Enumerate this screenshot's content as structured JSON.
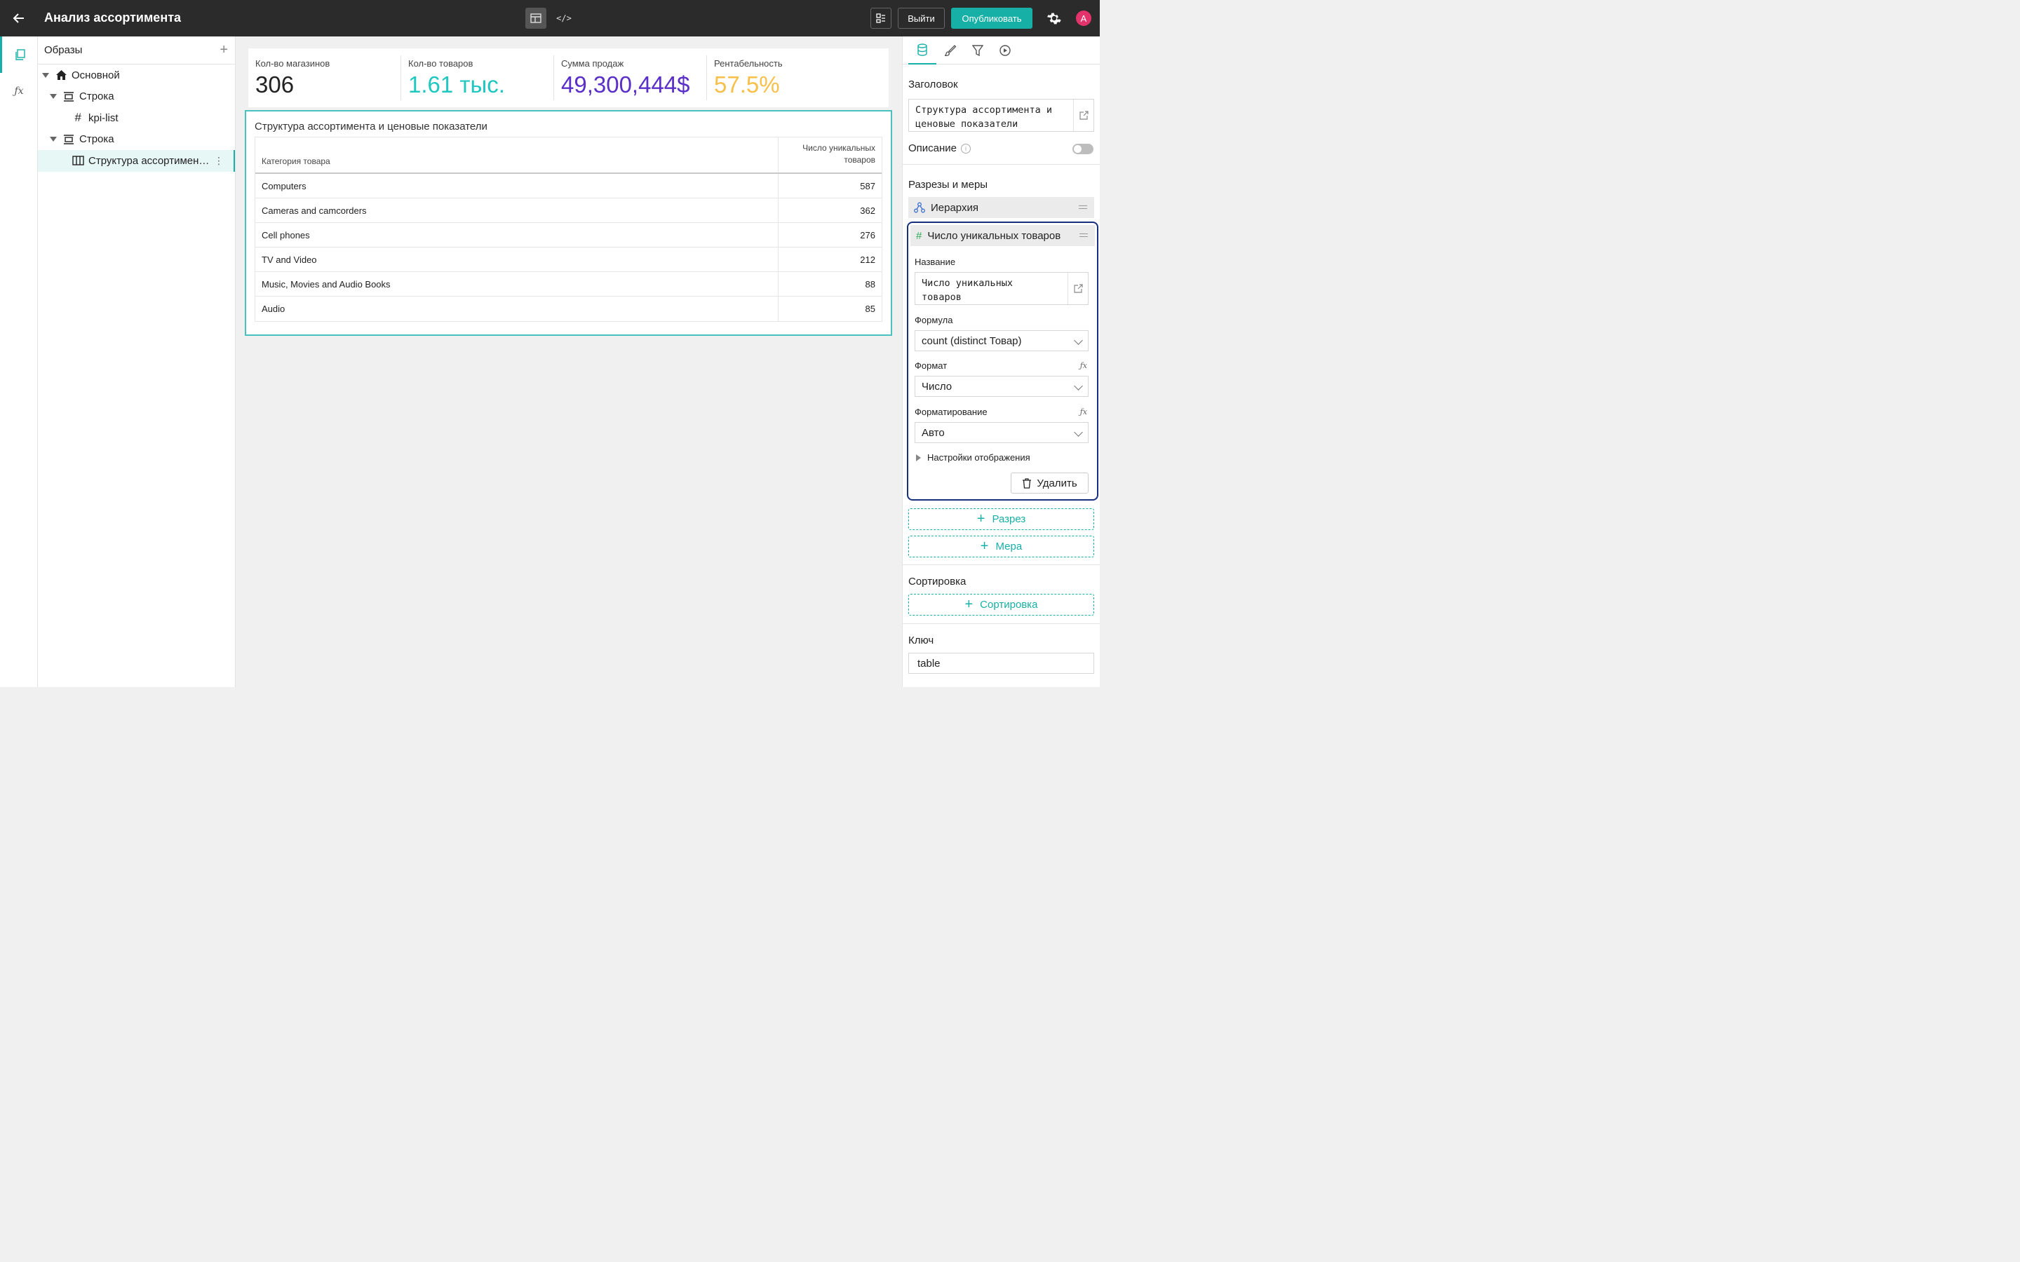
{
  "app": {
    "title": "Анализ ассортимента",
    "exit_label": "Выйти",
    "publish_label": "Опубликовать",
    "avatar_letter": "A",
    "code_mode_label": "</>"
  },
  "tree": {
    "header": "Образы",
    "nodes": [
      {
        "label": "Основной",
        "icon": "home-icon"
      },
      {
        "label": "Строка",
        "icon": "row-icon"
      },
      {
        "label": "kpi-list",
        "icon": "hash-icon"
      },
      {
        "label": "Строка",
        "icon": "row-icon"
      },
      {
        "label": "Структура ассортимента и ценовые показатели",
        "icon": "table-icon"
      }
    ]
  },
  "kpis": [
    {
      "label": "Кол-во магазинов",
      "value": "306",
      "color": "#222222"
    },
    {
      "label": "Кол-во товаров",
      "value": "1.61 тыс.",
      "color": "#1fc7c0"
    },
    {
      "label": "Сумма продаж",
      "value": "49,300,444$",
      "color": "#5a2fc8"
    },
    {
      "label": "Рентабельность",
      "value": "57.5%",
      "color": "#f7c04a"
    }
  ],
  "table": {
    "title": "Структура ассортимента и ценовые показатели",
    "columns": [
      "Категория товара",
      "Число уникальных товаров"
    ],
    "rows": [
      {
        "category": "Computers",
        "count": "587"
      },
      {
        "category": "Cameras and camcorders",
        "count": "362"
      },
      {
        "category": "Cell phones",
        "count": "276"
      },
      {
        "category": "TV and Video",
        "count": "212"
      },
      {
        "category": "Music, Movies and Audio Books",
        "count": "88"
      },
      {
        "category": "Audio",
        "count": "85"
      }
    ]
  },
  "props": {
    "title_label": "Заголовок",
    "title_value": "Структура ассортимента и ценовые показатели",
    "description_label": "Описание",
    "section_label": "Разрезы и меры",
    "hierarchy_label": "Иерархия",
    "measure_label": "Число уникальных товаров",
    "name_label": "Название",
    "name_value": "Число уникальных товаров",
    "formula_label": "Формула",
    "formula_value": "count (distinct Товар)",
    "format_label": "Формат",
    "format_value": "Число",
    "formatting_label": "Форматирование",
    "formatting_value": "Авто",
    "display_settings_label": "Настройки отображения",
    "delete_label": "Удалить",
    "add_dimension_label": "Разрез",
    "add_measure_label": "Мера",
    "sort_label": "Сортировка",
    "add_sort_label": "Сортировка",
    "key_label": "Ключ",
    "key_value": "table",
    "accent_color": "#17b0a6"
  }
}
